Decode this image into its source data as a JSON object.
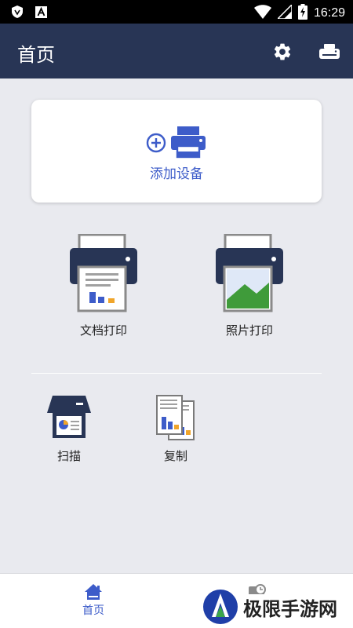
{
  "status_bar": {
    "time": "16:29",
    "left_icons": [
      "shield-app-icon",
      "a-app-icon"
    ],
    "right_icons": [
      "wifi-icon",
      "signal-icon",
      "battery-charging-icon"
    ]
  },
  "app_bar": {
    "title": "首页",
    "actions": [
      "gear-icon",
      "printer-icon"
    ]
  },
  "add_device": {
    "label": "添加设备",
    "icons": [
      "plus-circle-icon",
      "printer-icon"
    ]
  },
  "features": {
    "document_print": "文档打印",
    "photo_print": "照片打印",
    "scan": "扫描",
    "copy": "复制"
  },
  "bottom_nav": {
    "home": "首页"
  },
  "watermark": {
    "text": "极限手游网"
  },
  "colors": {
    "app_bar": "#283555",
    "accent": "#3d5cc9",
    "background": "#e9eaef"
  }
}
